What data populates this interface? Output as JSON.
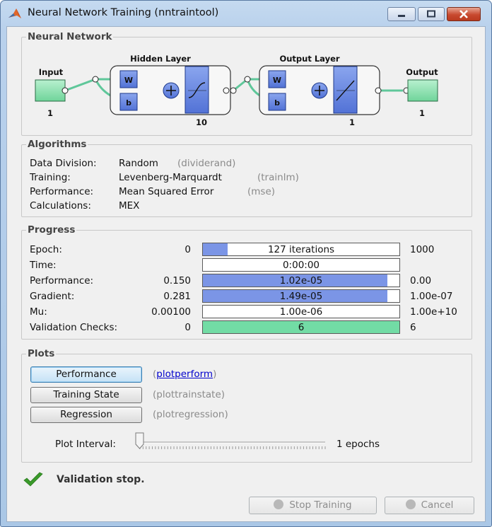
{
  "window": {
    "title": "Neural Network Training (nntraintool)",
    "icon": "matlab-icon"
  },
  "network": {
    "legend": "Neural Network",
    "input_label": "Input",
    "input_size": "1",
    "hidden_label": "Hidden Layer",
    "hidden_size": "10",
    "output_layer_label": "Output Layer",
    "output_layer_size": "1",
    "output_label": "Output",
    "output_size": "1",
    "w": "W",
    "b": "b"
  },
  "algorithms": {
    "legend": "Algorithms",
    "rows": [
      {
        "label": "Data Division:",
        "value": "Random",
        "fn": "(dividerand)"
      },
      {
        "label": "Training:",
        "value": "Levenberg-Marquardt",
        "fn": "(trainlm)"
      },
      {
        "label": "Performance:",
        "value": "Mean Squared Error",
        "fn": "(mse)"
      },
      {
        "label": "Calculations:",
        "value": "MEX",
        "fn": ""
      }
    ]
  },
  "progress": {
    "legend": "Progress",
    "rows": [
      {
        "label": "Epoch:",
        "start": "0",
        "current": "127 iterations",
        "end": "1000",
        "fraction": 0.127,
        "color": "#7b95e6"
      },
      {
        "label": "Time:",
        "start": "",
        "current": "0:00:00",
        "end": "",
        "fraction": 0,
        "color": "#7b95e6"
      },
      {
        "label": "Performance:",
        "start": "0.150",
        "current": "1.02e-05",
        "end": "0.00",
        "fraction": 0.94,
        "color": "#7b95e6"
      },
      {
        "label": "Gradient:",
        "start": "0.281",
        "current": "1.49e-05",
        "end": "1.00e-07",
        "fraction": 0.94,
        "color": "#7b95e6"
      },
      {
        "label": "Mu:",
        "start": "0.00100",
        "current": "1.00e-06",
        "end": "1.00e+10",
        "fraction": 0,
        "color": "#7b95e6"
      },
      {
        "label": "Validation Checks:",
        "start": "0",
        "current": "6",
        "end": "6",
        "fraction": 1.0,
        "color": "#72dca5"
      }
    ]
  },
  "plots": {
    "legend": "Plots",
    "buttons": [
      {
        "label": "Performance",
        "fn": "plotperform"
      },
      {
        "label": "Training State",
        "fn": "(plottrainstate)"
      },
      {
        "label": "Regression",
        "fn": "(plotregression)"
      }
    ],
    "interval_label": "Plot Interval:",
    "interval_value": "1 epochs",
    "interval_fraction": 0
  },
  "status": {
    "text": "Validation stop.",
    "icon": "checkmark-icon"
  },
  "footer": {
    "stop_label": "Stop Training",
    "cancel_label": "Cancel"
  }
}
